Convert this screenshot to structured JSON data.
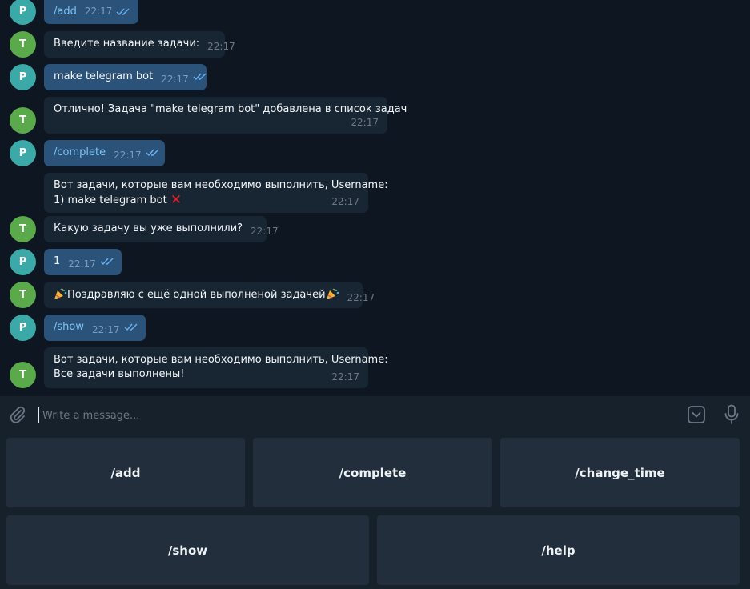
{
  "messages": [
    {
      "sender": "P",
      "dir": "out",
      "text": "/add",
      "time": "22:17"
    },
    {
      "sender": "T",
      "dir": "in",
      "text": "Введите название задачи:",
      "time": "22:17"
    },
    {
      "sender": "P",
      "dir": "out",
      "text": "make telegram bot",
      "time": "22:17"
    },
    {
      "sender": "T",
      "dir": "in",
      "text": "Отлично! Задача \"make telegram bot\" добавлена в список задач",
      "time": "22:17"
    },
    {
      "sender": "P",
      "dir": "out",
      "text": "/complete",
      "time": "22:17"
    },
    {
      "sender": "T",
      "dir": "in",
      "line1": "Вот задачи, которые вам необходимо выполнить, Username:",
      "line2": "1) make telegram bot",
      "line2_icon": "cross-mark-icon",
      "time": "22:17"
    },
    {
      "sender": "T",
      "dir": "in",
      "text": "Какую задачу вы уже выполнили?",
      "time": "22:17"
    },
    {
      "sender": "P",
      "dir": "out",
      "text": "1",
      "time": "22:17"
    },
    {
      "sender": "T",
      "dir": "in",
      "text": "Поздравляю с ещё одной выполненой задачей",
      "icons": [
        "party-popper-icon",
        "party-popper-icon"
      ],
      "time": "22:17"
    },
    {
      "sender": "P",
      "dir": "out",
      "text": "/show",
      "time": "22:17"
    },
    {
      "sender": "T",
      "dir": "in",
      "line1": "Вот задачи, которые вам необходимо выполнить, Username:",
      "line2": "Все задачи выполнены!",
      "time": "22:17"
    }
  ],
  "composer": {
    "placeholder": "Write a message...",
    "icons": [
      "paperclip-icon",
      "keyboard-toggle-icon",
      "microphone-icon"
    ]
  },
  "keyboard": {
    "row1": [
      "/add",
      "/complete",
      "/change_time"
    ],
    "row2": [
      "/show",
      "/help"
    ]
  },
  "colors": {
    "background": "#0e1621",
    "incoming_bubble": "#182533",
    "outgoing_bubble": "#2b5278",
    "outgoing_text": "#7dc4f5",
    "key_background": "#232e3c",
    "avatar_p": "#3aa9a7",
    "avatar_t": "#5aa94a"
  }
}
